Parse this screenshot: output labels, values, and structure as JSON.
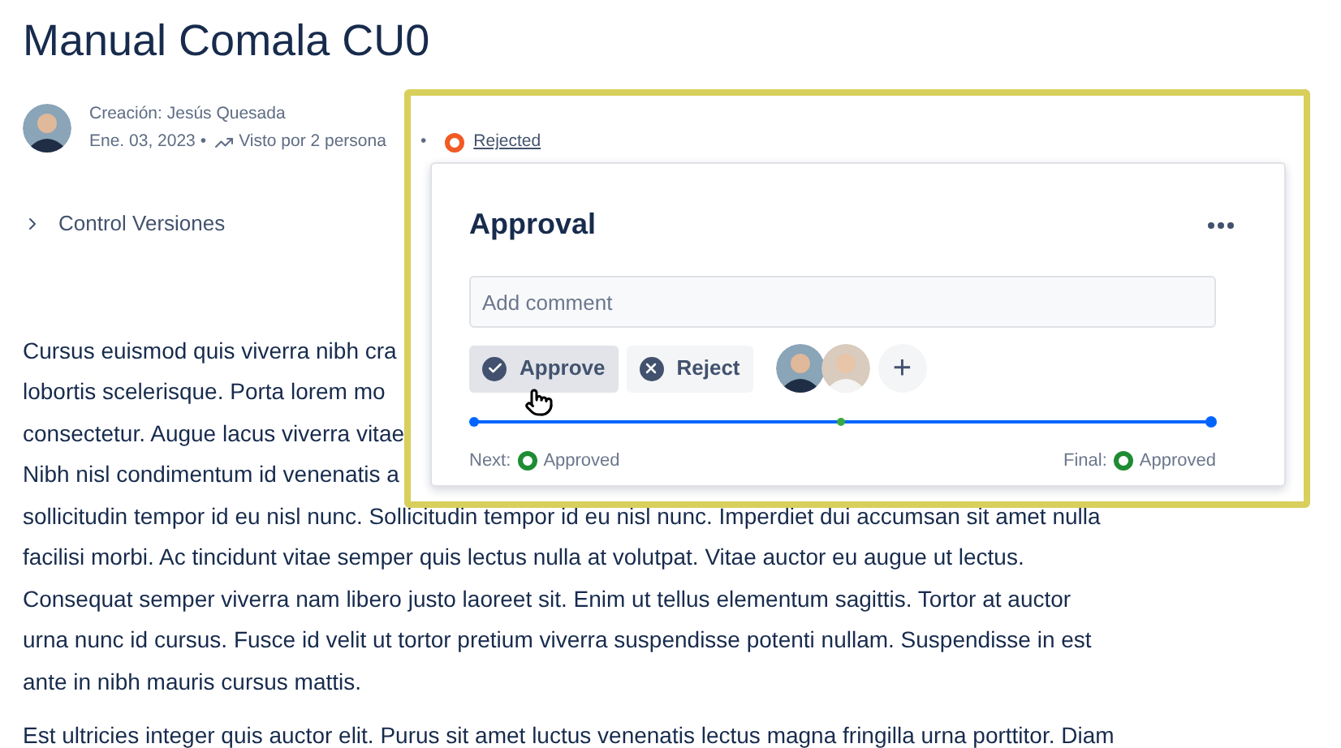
{
  "page": {
    "title": "Manual Comala CU0",
    "author": "Creación: Jesús Quesada",
    "date": "Ene. 03, 2023",
    "date_separator": "•",
    "views": "Visto por 2 persona",
    "status_separator": "•",
    "status": "Rejected"
  },
  "expander": {
    "label": "Control Versiones",
    "expanded": false
  },
  "body_lines": [
    "Cursus euismod quis viverra nibh cra",
    "lobortis scelerisque. Porta lorem mo",
    "consectetur. Augue lacus viverra vitae",
    "Nibh nisl condimentum id venenatis a",
    "sollicitudin tempor id eu nisl nunc. Sollicitudin tempor id eu nisl nunc. Imperdiet dui accumsan sit amet nulla",
    "facilisi morbi. Ac tincidunt vitae semper quis lectus nulla at volutpat. Vitae auctor eu augue ut lectus.",
    "Consequat semper viverra nam libero justo laoreet sit. Enim ut tellus elementum sagittis. Tortor at auctor",
    "urna nunc id cursus. Fusce id velit ut tortor pretium viverra suspendisse potenti nullam. Suspendisse in est",
    "ante in nibh mauris cursus mattis."
  ],
  "paragraph_2": "Est ultricies integer quis auctor elit. Purus sit amet luctus venenatis lectus magna fringilla urna porttitor. Diam",
  "approval_popup": {
    "title": "Approval",
    "comment_placeholder": "Add comment",
    "actions": [
      {
        "kind": "approve",
        "label": "Approve",
        "hovered": true
      },
      {
        "kind": "reject",
        "label": "Reject",
        "hovered": false
      }
    ],
    "add_reviewer": "+",
    "next_label": "Next:",
    "next_state": "Approved",
    "final_label": "Final:",
    "final_state": "Approved"
  }
}
